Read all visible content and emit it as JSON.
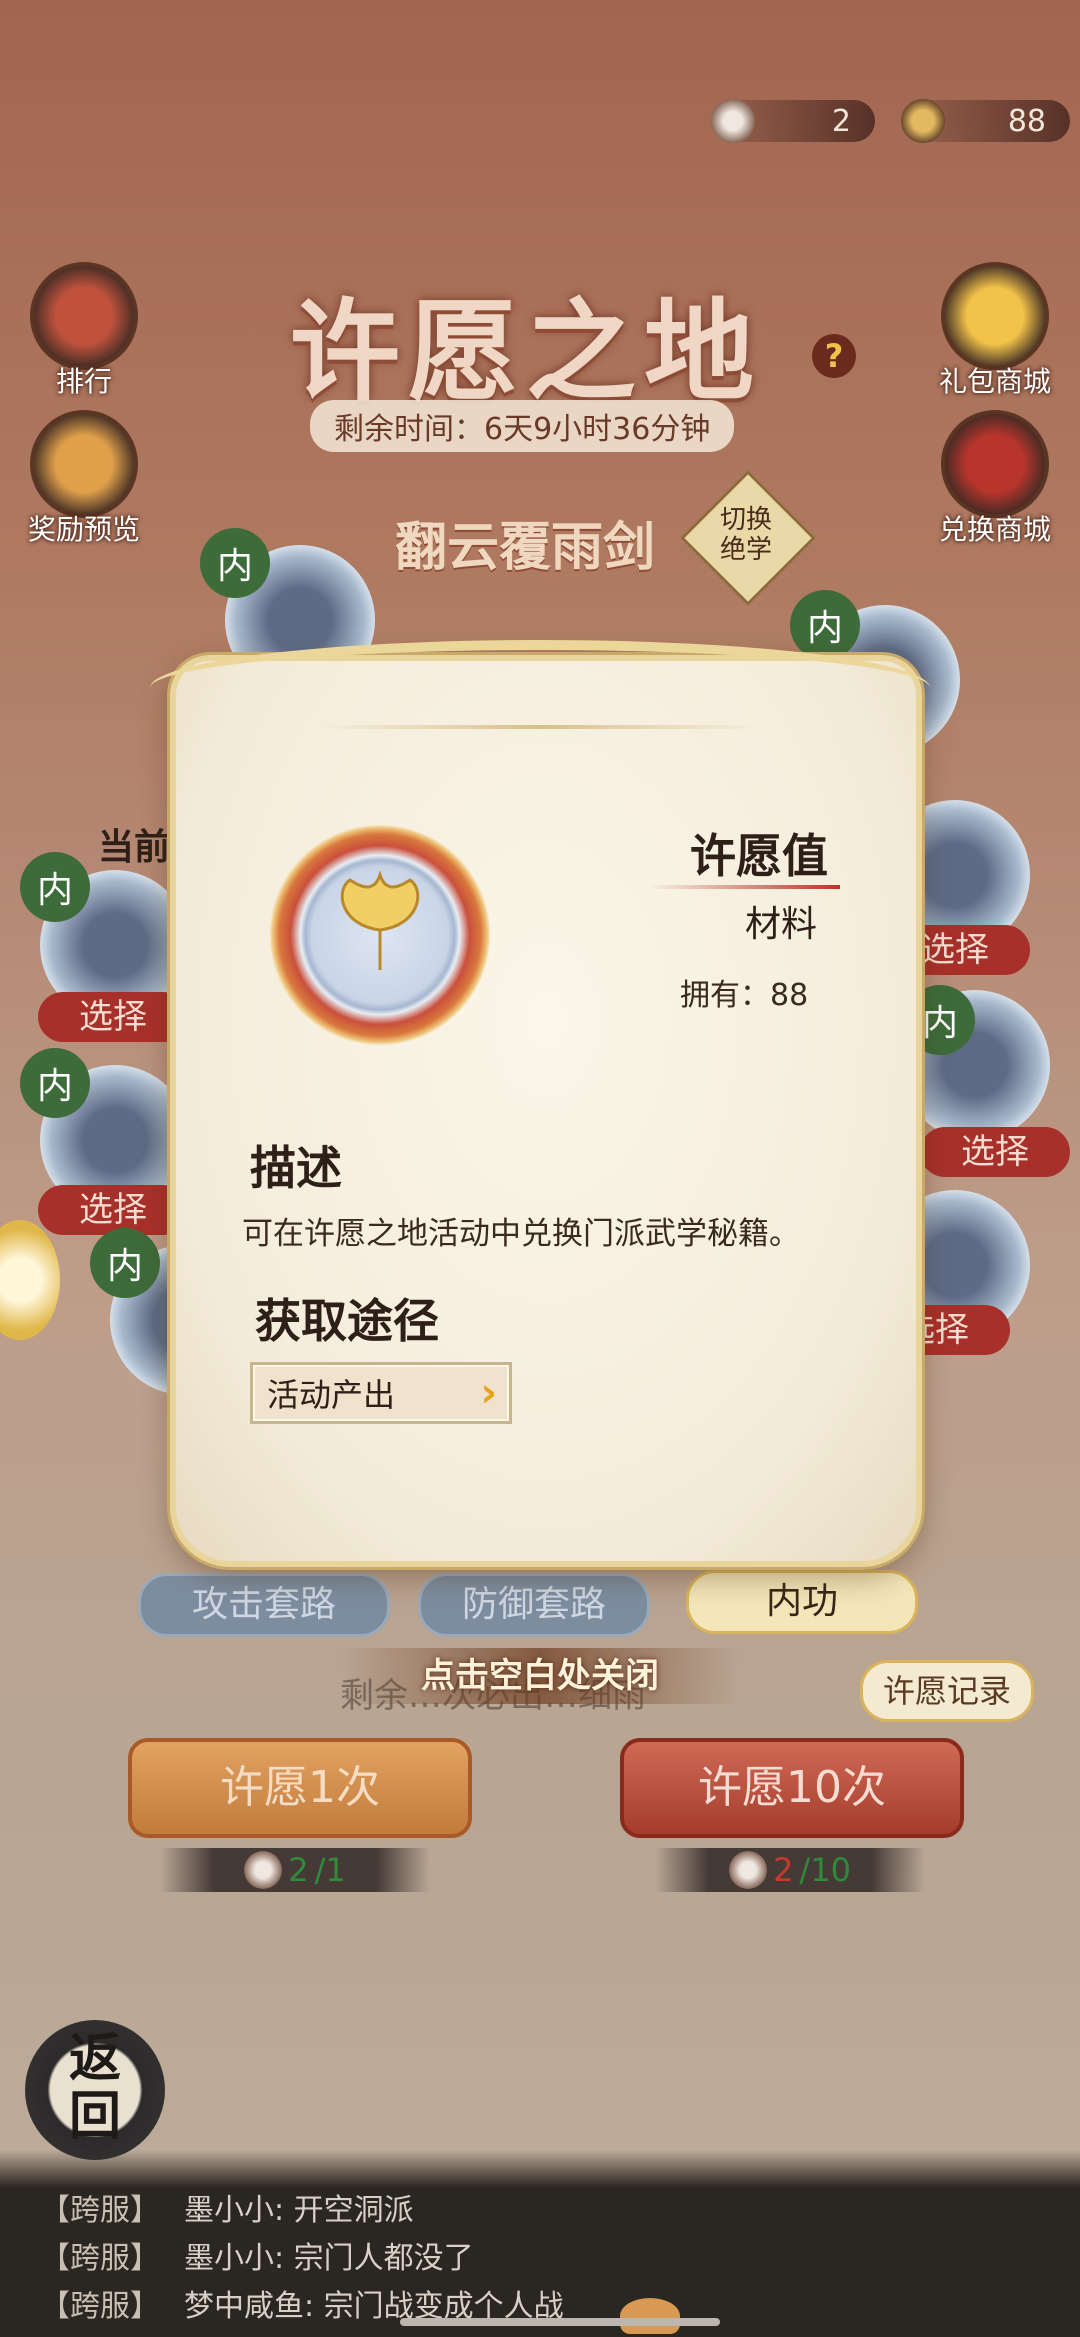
{
  "currency": [
    {
      "icon": "wish-token-icon",
      "value": "2"
    },
    {
      "icon": "ginkgo-leaf-icon",
      "value": "88"
    }
  ],
  "side_buttons": {
    "rank": "排行",
    "reward_preview": "奖励预览",
    "gift_shop": "礼包商城",
    "exchange_shop": "兑换商城"
  },
  "title": "许愿之地",
  "help": "?",
  "remaining_time": "剩余时间：6天9小时36分钟",
  "skill": {
    "name": "翻云覆雨剑",
    "switch_label": "切换\n绝学"
  },
  "characters": {
    "tag": "内",
    "select_label": "选择",
    "current_label": "当前"
  },
  "modal": {
    "item_name": "许愿值",
    "item_type": "材料",
    "owned": "拥有：88",
    "desc_title": "描述",
    "desc_text": "可在许愿之地活动中兑换门派武学秘籍。",
    "source_title": "获取途径",
    "source_button": "活动产出"
  },
  "tabs": [
    "攻击套路",
    "防御套路",
    "内功"
  ],
  "close_hint": "点击空白处关闭",
  "behind_hint": "剩余…次必出…细雨",
  "wish_record": "许愿记录",
  "wish_once": "许愿1次",
  "wish_ten": "许愿10次",
  "cost_once": {
    "have": "2",
    "need": "/1"
  },
  "cost_ten": {
    "have": "2",
    "need": "/10"
  },
  "back": "返\n回",
  "chat": [
    {
      "channel": "【跨服】",
      "text": "墨小小: 开空洞派"
    },
    {
      "channel": "【跨服】",
      "text": "墨小小: 宗门人都没了"
    },
    {
      "channel": "【跨服】",
      "text": "梦中咸鱼: 宗门战变成个人战"
    }
  ]
}
